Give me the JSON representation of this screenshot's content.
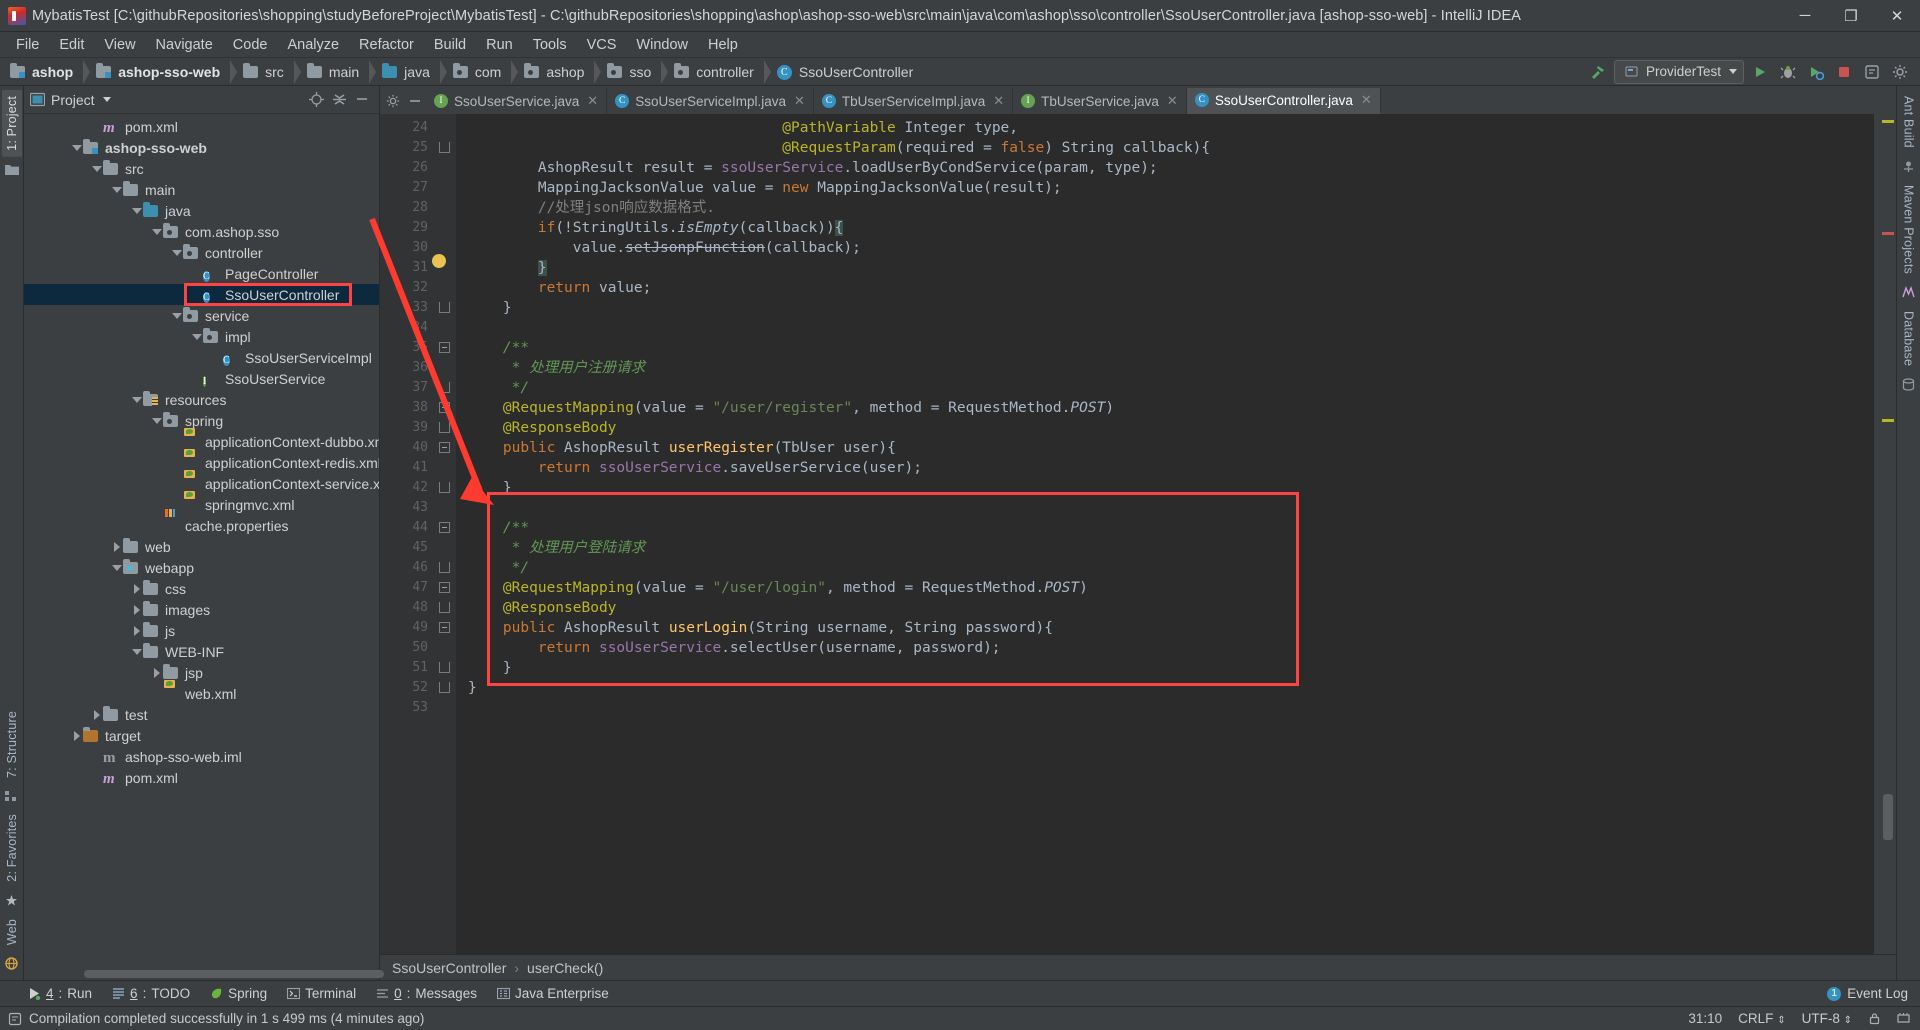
{
  "window": {
    "title": "MybatisTest [C:\\githubRepositories\\shopping\\studyBeforeProject\\MybatisTest] - C:\\githubRepositories\\shopping\\ashop\\ashop-sso-web\\src\\main\\java\\com\\ashop\\sso\\controller\\SsoUserController.java [ashop-sso-web] - IntelliJ IDEA",
    "minimize": "─",
    "maximize": "❐",
    "close": "✕"
  },
  "menubar": {
    "items": [
      "File",
      "Edit",
      "View",
      "Navigate",
      "Code",
      "Analyze",
      "Refactor",
      "Build",
      "Run",
      "Tools",
      "VCS",
      "Window",
      "Help"
    ]
  },
  "navbar": {
    "crumbs": [
      {
        "label": "ashop",
        "icon": "module-folder-icon",
        "bold": true
      },
      {
        "label": "ashop-sso-web",
        "icon": "module-folder-icon",
        "bold": true
      },
      {
        "label": "src",
        "icon": "folder-icon",
        "bold": false
      },
      {
        "label": "main",
        "icon": "folder-icon",
        "bold": false
      },
      {
        "label": "java",
        "icon": "source-folder-icon",
        "bold": false
      },
      {
        "label": "com",
        "icon": "package-icon",
        "bold": false
      },
      {
        "label": "ashop",
        "icon": "package-icon",
        "bold": false
      },
      {
        "label": "sso",
        "icon": "package-icon",
        "bold": false
      },
      {
        "label": "controller",
        "icon": "package-icon",
        "bold": false
      },
      {
        "label": "SsoUserController",
        "icon": "class-icon",
        "bold": false
      }
    ],
    "run_config": "ProviderTest"
  },
  "project_panel": {
    "title": "Project",
    "tree": [
      {
        "indent": 3,
        "arrow": "none",
        "icon": "maven-icon",
        "label": "pom.xml"
      },
      {
        "indent": 2,
        "arrow": "down",
        "icon": "module-folder-icon",
        "label": "ashop-sso-web",
        "bold": true
      },
      {
        "indent": 3,
        "arrow": "down",
        "icon": "folder-icon",
        "label": "src"
      },
      {
        "indent": 4,
        "arrow": "down",
        "icon": "folder-icon",
        "label": "main"
      },
      {
        "indent": 5,
        "arrow": "down",
        "icon": "source-folder-icon",
        "label": "java"
      },
      {
        "indent": 6,
        "arrow": "down",
        "icon": "package-icon",
        "label": "com.ashop.sso"
      },
      {
        "indent": 7,
        "arrow": "down",
        "icon": "package-icon",
        "label": "controller"
      },
      {
        "indent": 8,
        "arrow": "none",
        "icon": "class-icon",
        "label": "PageController"
      },
      {
        "indent": 8,
        "arrow": "none",
        "icon": "class-icon",
        "label": "SsoUserController",
        "selected": true,
        "highlighted": true
      },
      {
        "indent": 7,
        "arrow": "down",
        "icon": "package-icon",
        "label": "service"
      },
      {
        "indent": 8,
        "arrow": "down",
        "icon": "package-icon",
        "label": "impl"
      },
      {
        "indent": 9,
        "arrow": "none",
        "icon": "class-icon",
        "label": "SsoUserServiceImpl"
      },
      {
        "indent": 8,
        "arrow": "none",
        "icon": "interface-icon",
        "label": "SsoUserService"
      },
      {
        "indent": 5,
        "arrow": "down",
        "icon": "resource-folder-icon",
        "label": "resources"
      },
      {
        "indent": 6,
        "arrow": "down",
        "icon": "package-icon",
        "label": "spring"
      },
      {
        "indent": 7,
        "arrow": "none",
        "icon": "spring-xml-icon",
        "label": "applicationContext-dubbo.xml"
      },
      {
        "indent": 7,
        "arrow": "none",
        "icon": "spring-xml-icon",
        "label": "applicationContext-redis.xml"
      },
      {
        "indent": 7,
        "arrow": "none",
        "icon": "spring-xml-icon",
        "label": "applicationContext-service.xml"
      },
      {
        "indent": 7,
        "arrow": "none",
        "icon": "spring-xml-icon",
        "label": "springmvc.xml"
      },
      {
        "indent": 6,
        "arrow": "none",
        "icon": "properties-icon",
        "label": "cache.properties"
      },
      {
        "indent": 4,
        "arrow": "right",
        "icon": "folder-icon",
        "label": "web"
      },
      {
        "indent": 4,
        "arrow": "down",
        "icon": "web-folder-icon",
        "label": "webapp"
      },
      {
        "indent": 5,
        "arrow": "right",
        "icon": "folder-icon",
        "label": "css"
      },
      {
        "indent": 5,
        "arrow": "right",
        "icon": "folder-icon",
        "label": "images"
      },
      {
        "indent": 5,
        "arrow": "right",
        "icon": "folder-icon",
        "label": "js"
      },
      {
        "indent": 5,
        "arrow": "down",
        "icon": "folder-icon",
        "label": "WEB-INF"
      },
      {
        "indent": 6,
        "arrow": "right",
        "icon": "folder-icon",
        "label": "jsp"
      },
      {
        "indent": 6,
        "arrow": "none",
        "icon": "xml-icon",
        "label": "web.xml"
      },
      {
        "indent": 3,
        "arrow": "right",
        "icon": "folder-icon",
        "label": "test"
      },
      {
        "indent": 2,
        "arrow": "right",
        "icon": "target-folder-icon",
        "label": "target"
      },
      {
        "indent": 3,
        "arrow": "none",
        "icon": "iml-icon",
        "label": "ashop-sso-web.iml"
      },
      {
        "indent": 3,
        "arrow": "none",
        "icon": "maven-icon",
        "label": "pom.xml"
      }
    ]
  },
  "left_rail": {
    "tabs": [
      "1: Project",
      "7: Structure",
      "2: Favorites",
      "Web"
    ]
  },
  "right_rail": {
    "tabs": [
      "Ant Build",
      "Maven Projects",
      "Database"
    ]
  },
  "editor": {
    "tabs": [
      {
        "label": "SsoUserService.java",
        "icon": "interface-icon",
        "active": false
      },
      {
        "label": "SsoUserServiceImpl.java",
        "icon": "class-icon",
        "active": false
      },
      {
        "label": "TbUserServiceImpl.java",
        "icon": "class-icon",
        "active": false
      },
      {
        "label": "TbUserService.java",
        "icon": "interface-icon",
        "active": false
      },
      {
        "label": "SsoUserController.java",
        "icon": "class-icon",
        "active": true
      }
    ],
    "first_line_number": 24,
    "lines": [
      {
        "n": 24,
        "fold": "",
        "html": "                                    <span class='ann'>@PathVariable</span> <span class='typ'>Integer</span> type,"
      },
      {
        "n": 25,
        "fold": "end",
        "html": "                                    <span class='ann'>@RequestParam</span>(required = <span class='kw'>false</span>) String callback){"
      },
      {
        "n": 26,
        "fold": "",
        "html": "        AshopResult result = <span class='fld'>ssoUserService</span>.loadUserByCondService(param, type);"
      },
      {
        "n": 27,
        "fold": "",
        "html": "        MappingJacksonValue value = <span class='kw'>new</span> MappingJacksonValue(result);"
      },
      {
        "n": 28,
        "fold": "",
        "html": "        <span class='cmt2'>//处理json响应数据格式.</span>"
      },
      {
        "n": 29,
        "fold": "",
        "html": "        <span class='kw'>if</span>(!StringUtils.<span style='font-style:italic'>isEmpty</span>(callback))<span class='brace-hl'>{</span>"
      },
      {
        "n": 30,
        "fold": "",
        "html": "            value.<span class='strike'>setJsonpFunction</span>(callback);"
      },
      {
        "n": 31,
        "fold": "",
        "html": "        <span class='brace-hl'>}</span>"
      },
      {
        "n": 32,
        "fold": "",
        "html": "        <span class='kw'>return</span> value;"
      },
      {
        "n": 33,
        "fold": "end",
        "html": "    }"
      },
      {
        "n": 34,
        "fold": "",
        "html": ""
      },
      {
        "n": 35,
        "fold": "start",
        "html": "    <span class='cmt'>/**</span>"
      },
      {
        "n": 36,
        "fold": "",
        "html": "     <span class='cmt'>* 处理用户注册请求</span>"
      },
      {
        "n": 37,
        "fold": "end",
        "html": "     <span class='cmt'>*/</span>"
      },
      {
        "n": 38,
        "fold": "start",
        "html": "    <span class='ann'>@RequestMapping</span>(value = <span class='str'>\"/user/register\"</span>, method = RequestMethod.<span style='font-style:italic'>POST</span>)"
      },
      {
        "n": 39,
        "fold": "end",
        "html": "    <span class='ann'>@ResponseBody</span>"
      },
      {
        "n": 40,
        "fold": "start",
        "html": "    <span class='kw'>public</span> AshopResult <span class='mth'>userRegister</span>(TbUser user){"
      },
      {
        "n": 41,
        "fold": "",
        "html": "        <span class='kw'>return</span> <span class='fld'>ssoUserService</span>.saveUserService(user);"
      },
      {
        "n": 42,
        "fold": "end",
        "html": "    }"
      },
      {
        "n": 43,
        "fold": "",
        "html": ""
      },
      {
        "n": 44,
        "fold": "start",
        "html": "    <span class='cmt'>/**</span>"
      },
      {
        "n": 45,
        "fold": "",
        "html": "     <span class='cmt'>* 处理用户登陆请求</span>"
      },
      {
        "n": 46,
        "fold": "end",
        "html": "     <span class='cmt'>*/</span>"
      },
      {
        "n": 47,
        "fold": "start",
        "html": "    <span class='ann'>@RequestMapping</span>(value = <span class='str'>\"/user/login\"</span>, method = RequestMethod.<span style='font-style:italic'>POST</span>)"
      },
      {
        "n": 48,
        "fold": "end",
        "html": "    <span class='ann'>@ResponseBody</span>"
      },
      {
        "n": 49,
        "fold": "start",
        "html": "    <span class='kw'>public</span> AshopResult <span class='mth'>userLogin</span>(String username, String password){"
      },
      {
        "n": 50,
        "fold": "",
        "html": "        <span class='kw'>return</span> <span class='fld'>ssoUserService</span>.selectUser(username, password);"
      },
      {
        "n": 51,
        "fold": "end",
        "html": "    }"
      },
      {
        "n": 52,
        "fold": "end",
        "html": "}"
      },
      {
        "n": 53,
        "fold": "",
        "html": ""
      }
    ],
    "breadcrumb": {
      "class": "SsoUserController",
      "separator": "›",
      "method": "userCheck()"
    }
  },
  "toolwindow_bar": {
    "items": [
      {
        "num": "4",
        "label": "Run",
        "icon": "run-icon"
      },
      {
        "num": "6",
        "label": "TODO",
        "icon": "todo-icon"
      },
      {
        "num": "",
        "label": "Spring",
        "icon": "spring-leaf-icon"
      },
      {
        "num": "",
        "label": "Terminal",
        "icon": "terminal-icon"
      },
      {
        "num": "0",
        "label": "Messages",
        "icon": "messages-icon"
      },
      {
        "num": "",
        "label": "Java Enterprise",
        "icon": "java-ee-icon"
      }
    ],
    "event_log": "Event Log",
    "event_count": "1"
  },
  "statusbar": {
    "message": "Compilation completed successfully in 1 s 499 ms (4 minutes ago)",
    "caret": "31:10",
    "line_sep": "CRLF",
    "encoding": "UTF-8"
  },
  "colors": {
    "accent_blue": "#3592c4",
    "selection": "#0d293e",
    "annotation_red": "#ff4242",
    "keyword_orange": "#cc7832",
    "string_green": "#6a8759",
    "comment_green": "#629755",
    "annotation_yellow": "#bbb529",
    "field_purple": "#9876aa",
    "method_yellow": "#ffc66d"
  }
}
